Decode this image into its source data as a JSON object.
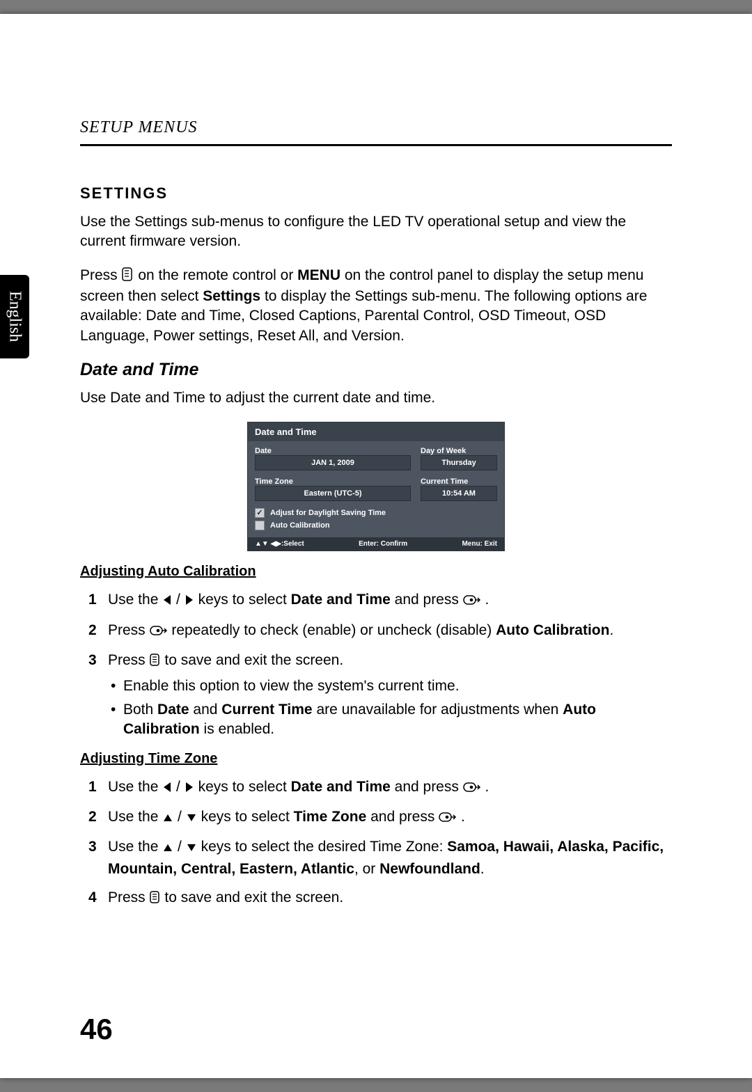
{
  "header": {
    "title": "SETUP MENUS"
  },
  "sideTab": "English",
  "pageNumber": "46",
  "settings": {
    "title": "SETTINGS",
    "intro": "Use the Settings sub-menus to configure the LED TV operational setup and view the current firmware version.",
    "press_1a": "Press ",
    "press_1b": " on the remote control or ",
    "press_menu": "MENU",
    "press_1c": " on the control panel to display the setup menu screen then select ",
    "press_settings": "Settings",
    "press_1d": " to display the Settings sub-menu. The following options are available: Date and Time, Closed Captions, Parental Control, OSD Timeout, OSD Language, Power settings, Reset All, and Version."
  },
  "dateTime": {
    "title": "Date and Time",
    "intro": "Use Date and Time to adjust the current date and time."
  },
  "osd": {
    "title": "Date and Time",
    "dateLabel": "Date",
    "dateValue": "JAN 1, 2009",
    "dowLabel": "Day of Week",
    "dowValue": "Thursday",
    "tzLabel": "Time Zone",
    "tzValue": "Eastern (UTC-5)",
    "ctLabel": "Current Time",
    "ctValue": "10:54 AM",
    "dst": "Adjust for Daylight Saving Time",
    "autoCal": "Auto Calibration",
    "footSelect": "▲▼ ◀▶:Select",
    "footConfirm": "Enter: Confirm",
    "footExit": "Menu: Exit"
  },
  "adjAutoCal": {
    "heading": "Adjusting Auto Calibration",
    "s1a": "Use the ",
    "s1b": " keys to select ",
    "s1_dt": "Date and Time",
    "s1c": " and press ",
    "s1d": ".",
    "s2a": "Press ",
    "s2b": " repeatedly to check (enable) or uncheck (disable) ",
    "s2_ac": "Auto Calibration",
    "s2c": ".",
    "s3a": "Press ",
    "s3b": " to save and exit the screen.",
    "b1": "Enable this option to view the system's current time.",
    "b2a": "Both ",
    "b2_date": "Date",
    "b2b": " and ",
    "b2_ct": "Current Time",
    "b2c": " are unavailable for adjustments when ",
    "b2_ac": "Auto Calibration",
    "b2d": " is enabled."
  },
  "adjTZ": {
    "heading": "Adjusting Time Zone",
    "s1a": "Use the ",
    "s1b": " keys to select ",
    "s1_dt": "Date and Time",
    "s1c": " and press ",
    "s1d": ".",
    "s2a": "Use the ",
    "s2b": " keys to select ",
    "s2_tz": "Time Zone",
    "s2c": " and press ",
    "s2d": ".",
    "s3a": "Use the ",
    "s3b": " keys to select the desired Time Zone: ",
    "s3_list": "Samoa, Hawaii, Alaska, Pacific, Mountain, Central, Eastern, Atlantic",
    "s3c": ", or ",
    "s3_nf": "Newfoundland",
    "s3d": ".",
    "s4a": "Press ",
    "s4b": " to save and exit the screen."
  }
}
